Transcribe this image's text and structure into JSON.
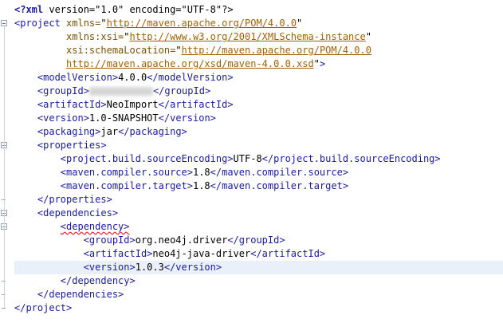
{
  "editor": {
    "lines": [
      {
        "indent": 0,
        "fold": "none",
        "parts": [
          {
            "c": "decl",
            "t": "<?xml"
          },
          {
            "c": "txt",
            "t": " version=\"1.0\" encoding=\"UTF-8\"?>"
          }
        ]
      },
      {
        "indent": 0,
        "fold": "open",
        "parts": [
          {
            "c": "tag",
            "t": "<project "
          },
          {
            "c": "attr",
            "t": "xmlns="
          },
          {
            "c": "txt",
            "t": "\""
          },
          {
            "c": "url",
            "t": "http://maven.apache.org/POM/4.0.0"
          },
          {
            "c": "txt",
            "t": "\""
          }
        ]
      },
      {
        "indent": 0,
        "fold": "none",
        "parts": [
          {
            "c": "txt",
            "t": "         "
          },
          {
            "c": "attr",
            "t": "xmlns:xsi="
          },
          {
            "c": "txt",
            "t": "\""
          },
          {
            "c": "url",
            "t": "http://www.w3.org/2001/XMLSchema-instance"
          },
          {
            "c": "txt",
            "t": "\""
          }
        ]
      },
      {
        "indent": 0,
        "fold": "none",
        "parts": [
          {
            "c": "txt",
            "t": "         "
          },
          {
            "c": "attr",
            "t": "xsi:schemaLocation="
          },
          {
            "c": "txt",
            "t": "\""
          },
          {
            "c": "url",
            "t": "http://maven.apache.org/POM/4.0.0"
          }
        ]
      },
      {
        "indent": 0,
        "fold": "none",
        "parts": [
          {
            "c": "txt",
            "t": "         "
          },
          {
            "c": "url",
            "t": "http://maven.apache.org/xsd/maven-4.0.0.xsd"
          },
          {
            "c": "txt",
            "t": "\""
          },
          {
            "c": "tag",
            "t": ">"
          }
        ]
      },
      {
        "indent": 1,
        "fold": "none",
        "parts": [
          {
            "c": "tag",
            "t": "<modelVersion>"
          },
          {
            "c": "txt",
            "t": "4.0.0"
          },
          {
            "c": "tag",
            "t": "</modelVersion>"
          }
        ]
      },
      {
        "indent": 1,
        "fold": "none",
        "parts": [
          {
            "c": "tag",
            "t": "<groupId>"
          },
          {
            "c": "blur",
            "t": ""
          },
          {
            "c": "tag",
            "t": "</groupId>"
          }
        ]
      },
      {
        "indent": 1,
        "fold": "none",
        "parts": [
          {
            "c": "tag",
            "t": "<artifactId>"
          },
          {
            "c": "txt",
            "t": "NeoImport"
          },
          {
            "c": "tag",
            "t": "</artifactId>"
          }
        ]
      },
      {
        "indent": 1,
        "fold": "none",
        "parts": [
          {
            "c": "tag",
            "t": "<version>"
          },
          {
            "c": "txt",
            "t": "1.0-SNAPSHOT"
          },
          {
            "c": "tag",
            "t": "</version>"
          }
        ]
      },
      {
        "indent": 1,
        "fold": "none",
        "parts": [
          {
            "c": "tag",
            "t": "<packaging>"
          },
          {
            "c": "txt",
            "t": "jar"
          },
          {
            "c": "tag",
            "t": "</packaging>"
          }
        ]
      },
      {
        "indent": 1,
        "fold": "open",
        "parts": [
          {
            "c": "tag",
            "t": "<properties>"
          }
        ]
      },
      {
        "indent": 2,
        "fold": "none",
        "parts": [
          {
            "c": "tag",
            "t": "<project.build.sourceEncoding>"
          },
          {
            "c": "txt",
            "t": "UTF-8"
          },
          {
            "c": "tag",
            "t": "</project.build.sourceEncoding>"
          }
        ]
      },
      {
        "indent": 2,
        "fold": "none",
        "parts": [
          {
            "c": "tag",
            "t": "<maven.compiler.source>"
          },
          {
            "c": "txt",
            "t": "1.8"
          },
          {
            "c": "tag",
            "t": "</maven.compiler.source>"
          }
        ]
      },
      {
        "indent": 2,
        "fold": "none",
        "parts": [
          {
            "c": "tag",
            "t": "<maven.compiler.target>"
          },
          {
            "c": "txt",
            "t": "1.8"
          },
          {
            "c": "tag",
            "t": "</maven.compiler.target>"
          }
        ]
      },
      {
        "indent": 1,
        "fold": "end",
        "parts": [
          {
            "c": "tag",
            "t": "</properties>"
          }
        ]
      },
      {
        "indent": 1,
        "fold": "open",
        "parts": [
          {
            "c": "tag",
            "t": "<dependencies>"
          }
        ]
      },
      {
        "indent": 2,
        "fold": "open",
        "parts": [
          {
            "c": "tag err",
            "t": "<dependency>"
          }
        ]
      },
      {
        "indent": 3,
        "fold": "none",
        "parts": [
          {
            "c": "tag",
            "t": "<groupId>"
          },
          {
            "c": "txt",
            "t": "org.neo4j.driver"
          },
          {
            "c": "tag",
            "t": "</groupId>"
          }
        ]
      },
      {
        "indent": 3,
        "fold": "none",
        "parts": [
          {
            "c": "tag",
            "t": "<artifactId>"
          },
          {
            "c": "txt",
            "t": "neo4j-java-driver"
          },
          {
            "c": "tag",
            "t": "</artifactId>"
          }
        ]
      },
      {
        "indent": 3,
        "fold": "none",
        "current": true,
        "parts": [
          {
            "c": "tag",
            "t": "<version>"
          },
          {
            "c": "txt",
            "t": "1.0.3"
          },
          {
            "c": "tag",
            "t": "</version>"
          }
        ]
      },
      {
        "indent": 2,
        "fold": "end",
        "parts": [
          {
            "c": "tag",
            "t": "</dependency>"
          }
        ]
      },
      {
        "indent": 1,
        "fold": "end",
        "parts": [
          {
            "c": "tag",
            "t": "</dependencies>"
          }
        ]
      },
      {
        "indent": 0,
        "fold": "end",
        "parts": [
          {
            "c": "tag",
            "t": "</project>"
          }
        ]
      }
    ]
  }
}
